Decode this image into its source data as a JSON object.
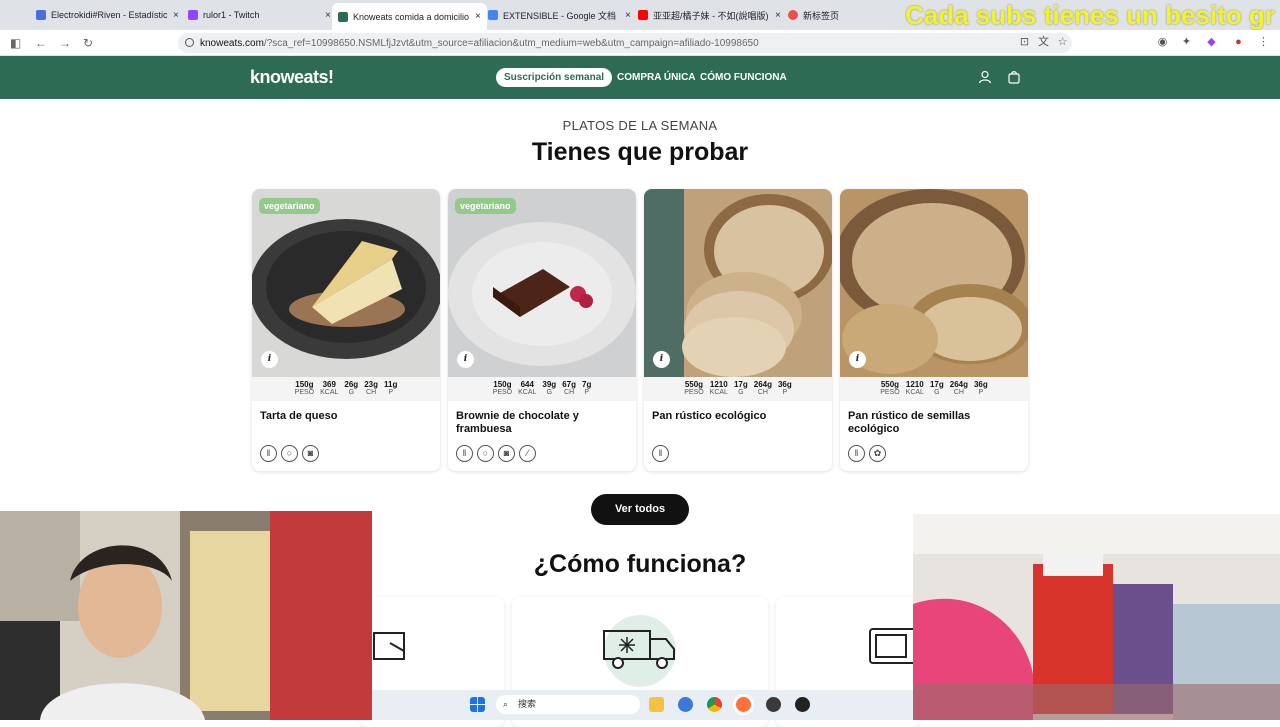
{
  "browser": {
    "tabs": [
      {
        "title": "Electrokidi#Riven - Estadístic",
        "color": "#4a6ee0"
      },
      {
        "title": "rulor1 - Twitch",
        "color": "#9146ff"
      },
      {
        "title": "Knoweats comida a domicilio",
        "color": "#2e6b55"
      },
      {
        "title": "EXTENSIBLE - Google 文档",
        "color": "#4285f4"
      },
      {
        "title": "亚亚超/橘子妹 - 不如(說唱版)",
        "color": "#ff0000"
      },
      {
        "title": "新标签页",
        "color": "#e94f4f"
      }
    ],
    "overlay_text": "Cada subs tienes un besito gr",
    "url_host": "knoweats.com",
    "url_rest": "/?sca_ref=10998650.NSMLfjJzvt&utm_source=afiliacion&utm_medium=web&utm_campaign=afiliado-10998650"
  },
  "header": {
    "logo": "knoweats!",
    "pill": "Suscripción semanal",
    "nav": [
      "COMPRA ÚNICA",
      "CÓMO FUNCIONA"
    ]
  },
  "section": {
    "subtitle": "PLATOS DE LA SEMANA",
    "title": "Tienes que probar"
  },
  "labels": {
    "peso": "PESO",
    "kcal": "KCAL",
    "g": "G",
    "ch": "CH",
    "p": "P"
  },
  "cards": [
    {
      "badge": "vegetariano",
      "name": "Tarta de queso",
      "peso": "150g",
      "kcal": "369",
      "g": "26g",
      "ch": "23g",
      "p": "11g",
      "allergens": [
        "gluten-icon",
        "egg-icon",
        "milk-icon"
      ]
    },
    {
      "badge": "vegetariano",
      "name": "Brownie de chocolate y frambuesa",
      "peso": "150g",
      "kcal": "644",
      "g": "39g",
      "ch": "67g",
      "p": "7g",
      "allergens": [
        "gluten-icon",
        "egg-icon",
        "milk-icon",
        "nuts-icon"
      ]
    },
    {
      "badge": "",
      "name": "Pan rústico ecológico",
      "peso": "550g",
      "kcal": "1210",
      "g": "17g",
      "ch": "264g",
      "p": "36g",
      "allergens": [
        "gluten-icon"
      ]
    },
    {
      "badge": "",
      "name": "Pan rústico de semillas ecológico",
      "peso": "550g",
      "kcal": "1210",
      "g": "17g",
      "ch": "264g",
      "p": "36g",
      "allergens": [
        "gluten-icon",
        "seeds-icon"
      ]
    }
  ],
  "ver_todos": "Ver todos",
  "how_title": "¿Cómo funciona?",
  "taskbar": {
    "search_placeholder": "搜索"
  }
}
